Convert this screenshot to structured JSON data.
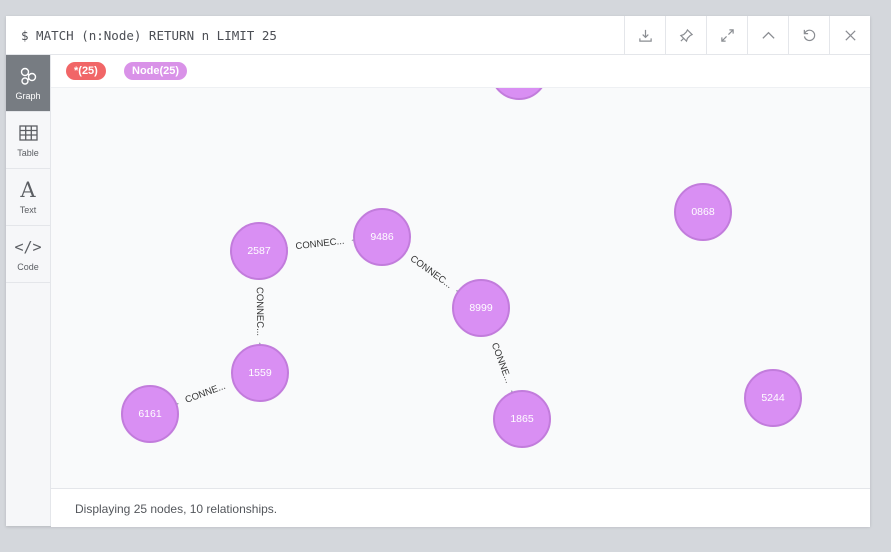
{
  "query": "$ MATCH (n:Node) RETURN n LIMIT 25",
  "toolbar": [
    "download-icon",
    "pin-icon",
    "expand-icon",
    "collapse-icon",
    "rerun-icon",
    "close-icon"
  ],
  "sidebar": {
    "items": [
      {
        "label": "Graph",
        "icon": "graph-icon",
        "active": true
      },
      {
        "label": "Table",
        "icon": "table-icon",
        "active": false
      },
      {
        "label": "Text",
        "icon": "text-icon",
        "active": false
      },
      {
        "label": "Code",
        "icon": "code-icon",
        "active": false
      }
    ]
  },
  "tags": {
    "all_label": "*(25)",
    "node_label": "Node(25)",
    "all_color": "#f16667",
    "node_color": "#d992e8"
  },
  "graph": {
    "node_fill": "#d98ff3",
    "node_stroke": "#c27cdc",
    "edge_color": "#a5abb6",
    "nodes": [
      {
        "id": "2587",
        "label": "2587"
      },
      {
        "id": "9486",
        "label": "9486"
      },
      {
        "id": "8999",
        "label": "8999"
      },
      {
        "id": "1559",
        "label": "1559"
      },
      {
        "id": "6161",
        "label": "6161"
      },
      {
        "id": "1865",
        "label": "1865"
      },
      {
        "id": "0868",
        "label": "0868"
      },
      {
        "id": "5244",
        "label": "5244"
      },
      {
        "id": "top-partial",
        "label": ""
      }
    ],
    "relationships": [
      {
        "from": "2587",
        "to": "9486",
        "label": "CONNEC..."
      },
      {
        "from": "9486",
        "to": "8999",
        "label": "CONNEC..."
      },
      {
        "from": "2587",
        "to": "1559",
        "label": "CONNEC..."
      },
      {
        "from": "1559",
        "to": "6161",
        "label": "CONNE..."
      },
      {
        "from": "8999",
        "to": "1865",
        "label": "CONNE..."
      }
    ]
  },
  "status": "Displaying 25 nodes, 10 relationships."
}
